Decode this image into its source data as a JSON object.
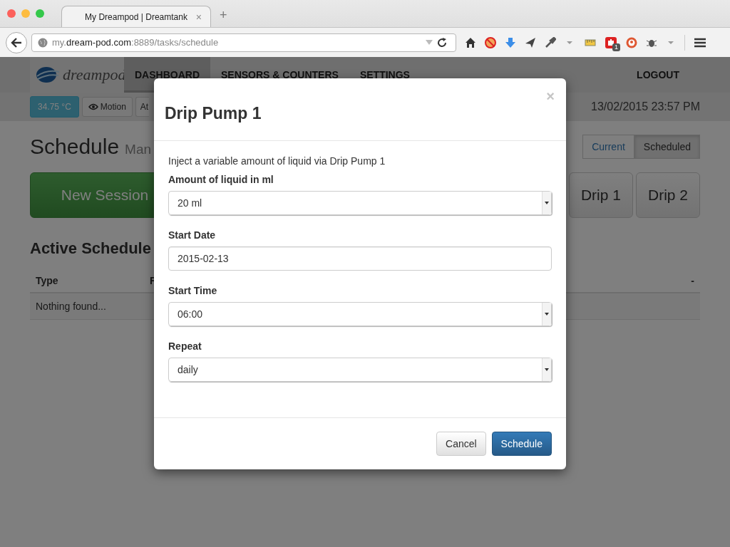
{
  "browser": {
    "tab": {
      "title": "My Dreampod | Dreamtank",
      "close": "×",
      "new_tab": "+"
    },
    "url": "my.**dream-pod.com**:8889/tasks/schedule",
    "extension_badge": "1"
  },
  "navbar": {
    "logo": "dreampod",
    "items": [
      {
        "label": "DASHBOARD",
        "selected": true
      },
      {
        "label": "SENSORS & COUNTERS",
        "selected": false
      },
      {
        "label": "SETTINGS",
        "selected": false
      }
    ],
    "logout": "LOGOUT"
  },
  "status_bar": {
    "temperature": "34.75 °C",
    "sensors": [
      {
        "label": "Motion",
        "kind": "icon"
      },
      {
        "label": "At",
        "kind": "plain"
      }
    ],
    "datetime": "13/02/2015 23:57 PM"
  },
  "page": {
    "title": "Schedule",
    "subtitle": "Man",
    "view_toggle": [
      {
        "label": "Current",
        "selected": false
      },
      {
        "label": "Scheduled",
        "selected": true
      }
    ],
    "actions": [
      {
        "label": "New Session",
        "kind": "primary"
      },
      {
        "label": "Drip 1",
        "kind": "default"
      },
      {
        "label": "Drip 2",
        "kind": "default"
      }
    ],
    "section_title": "Active Schedule",
    "table": {
      "columns": [
        "Type",
        "F",
        "-"
      ],
      "empty": "Nothing found..."
    }
  },
  "modal": {
    "title": "Drip Pump 1",
    "close": "×",
    "description": "Inject a variable amount of liquid via Drip Pump 1",
    "fields": [
      {
        "label": "Amount of liquid in ml",
        "kind": "select",
        "value": "20 ml"
      },
      {
        "label": "Start Date",
        "kind": "text",
        "value": "2015-02-13"
      },
      {
        "label": "Start Time",
        "kind": "select",
        "value": "06:00"
      },
      {
        "label": "Repeat",
        "kind": "select",
        "value": "daily"
      }
    ],
    "buttons": [
      {
        "label": "Cancel",
        "kind": "default"
      },
      {
        "label": "Schedule",
        "kind": "primary"
      }
    ]
  }
}
